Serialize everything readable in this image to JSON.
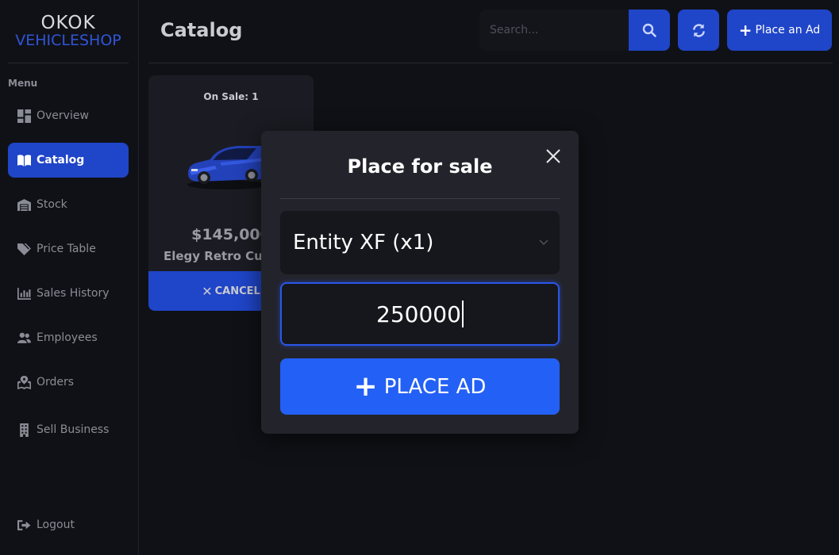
{
  "sidebar": {
    "logo_line1": "OKOK",
    "logo_line2": "VEHICLESHOP",
    "menu_title": "Menu",
    "items": [
      {
        "label": "Overview",
        "icon": "dashboard-icon"
      },
      {
        "label": "Catalog",
        "icon": "book-icon",
        "active": true
      },
      {
        "label": "Stock",
        "icon": "warehouse-icon"
      },
      {
        "label": "Price Table",
        "icon": "tags-icon"
      },
      {
        "label": "Sales History",
        "icon": "chart-bar-icon"
      },
      {
        "label": "Employees",
        "icon": "users-icon"
      },
      {
        "label": "Orders",
        "icon": "map-marked-icon"
      },
      {
        "label": "Sell Business",
        "icon": "building-icon"
      }
    ],
    "logout_label": "Logout"
  },
  "header": {
    "title": "Catalog",
    "search_placeholder": "Search...",
    "place_ad_label": "Place an Ad"
  },
  "card": {
    "on_sale": "On Sale: 1",
    "price": "$145,000",
    "model": "Elegy Retro Custom",
    "cancel_label": "CANCEL"
  },
  "modal": {
    "title": "Place for sale",
    "selected_vehicle": "Entity XF (x1)",
    "price_value": "250000",
    "place_button_label": "PLACE AD"
  },
  "colors": {
    "accent": "#1f45c8",
    "accent_bright": "#2360f5",
    "background": "#101116",
    "panel": "#23242b"
  }
}
